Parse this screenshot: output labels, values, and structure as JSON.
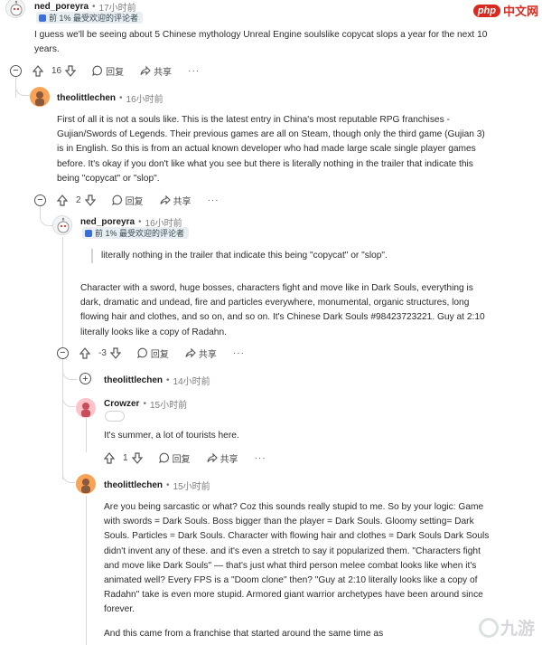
{
  "watermarks": {
    "php_logo": "php",
    "php_text": "中文网",
    "jiuyou_text": "九游"
  },
  "comments": [
    {
      "user": "ned_poreyra",
      "time": "17小时前",
      "badge": "前 1% 最受欢迎的评论者",
      "body": [
        "I guess we'll be seeing about 5 Chinese mythology Unreal Engine soulslike copycat slops a year for the next 10",
        "years."
      ],
      "votes": "16",
      "reply": "回复",
      "share": "共享",
      "more": "···"
    },
    {
      "user": "theolittlechen",
      "time": "16小时前",
      "body": [
        "First of all it is not a souls like. This is the latest entry in China's most reputable RPG franchises -",
        "Gujian/Swords of Legends. Their previous games are all on Steam, though only the third game (Gujian 3)",
        "is in English. So this is from an actual known developer who had made large scale single player games",
        "before. It's okay if you don't like what you see but there is literally nothing in the trailer that indicate this",
        "being \"copycat\" or \"slop\"."
      ],
      "votes": "2",
      "reply": "回复",
      "share": "共享",
      "more": "···"
    },
    {
      "user": "ned_poreyra",
      "time": "16小时前",
      "badge": "前 1% 最受欢迎的评论者",
      "quote": "literally nothing in the trailer that indicate this being \"copycat\" or \"slop\".",
      "body": [
        "Character with a sword, huge bosses, characters fight and move like in Dark Souls, everything is",
        "dark, dramatic and undead, fire and particles everywhere, monumental, organic structures, long",
        "flowing hair and clothes, and so on, and so on. It's Chinese Dark Souls #98423723221. Guy at 2:10",
        "literally looks like a copy of Radahn."
      ],
      "votes": "-3",
      "reply": "回复",
      "share": "共享",
      "more": "···"
    },
    {
      "user": "theolittlechen",
      "time": "14小时前"
    },
    {
      "user": "Crowzer",
      "time": "15小时前",
      "body": [
        "It's summer, a lot of tourists here."
      ],
      "votes": "1",
      "reply": "回复",
      "share": "共享",
      "more": "···"
    },
    {
      "user": "theolittlechen",
      "time": "15小时前",
      "body": [
        "Are you being sarcastic or what? Coz this sounds really stupid to me. So by your logic: Game",
        "with swords = Dark Souls. Boss bigger than the player = Dark Souls. Gloomy setting= Dark",
        "Souls. Particles = Dark Souls. Character with flowing hair and clothes = Dark Souls Dark Souls",
        "didn't invent any of these. and it's even a stretch to say it popularized them. \"Characters fight",
        "and move like Dark Souls\" — that's just what third person melee combat looks like when it's",
        "animated well? Every FPS is a \"Doom clone\" then? \"Guy at 2:10 literally looks like a copy of",
        "Radahn\" take is even more stupid. Armored giant warrior archetypes have been around since",
        "forever."
      ],
      "body2": "And this came from a franchise that started around the same time as"
    }
  ]
}
